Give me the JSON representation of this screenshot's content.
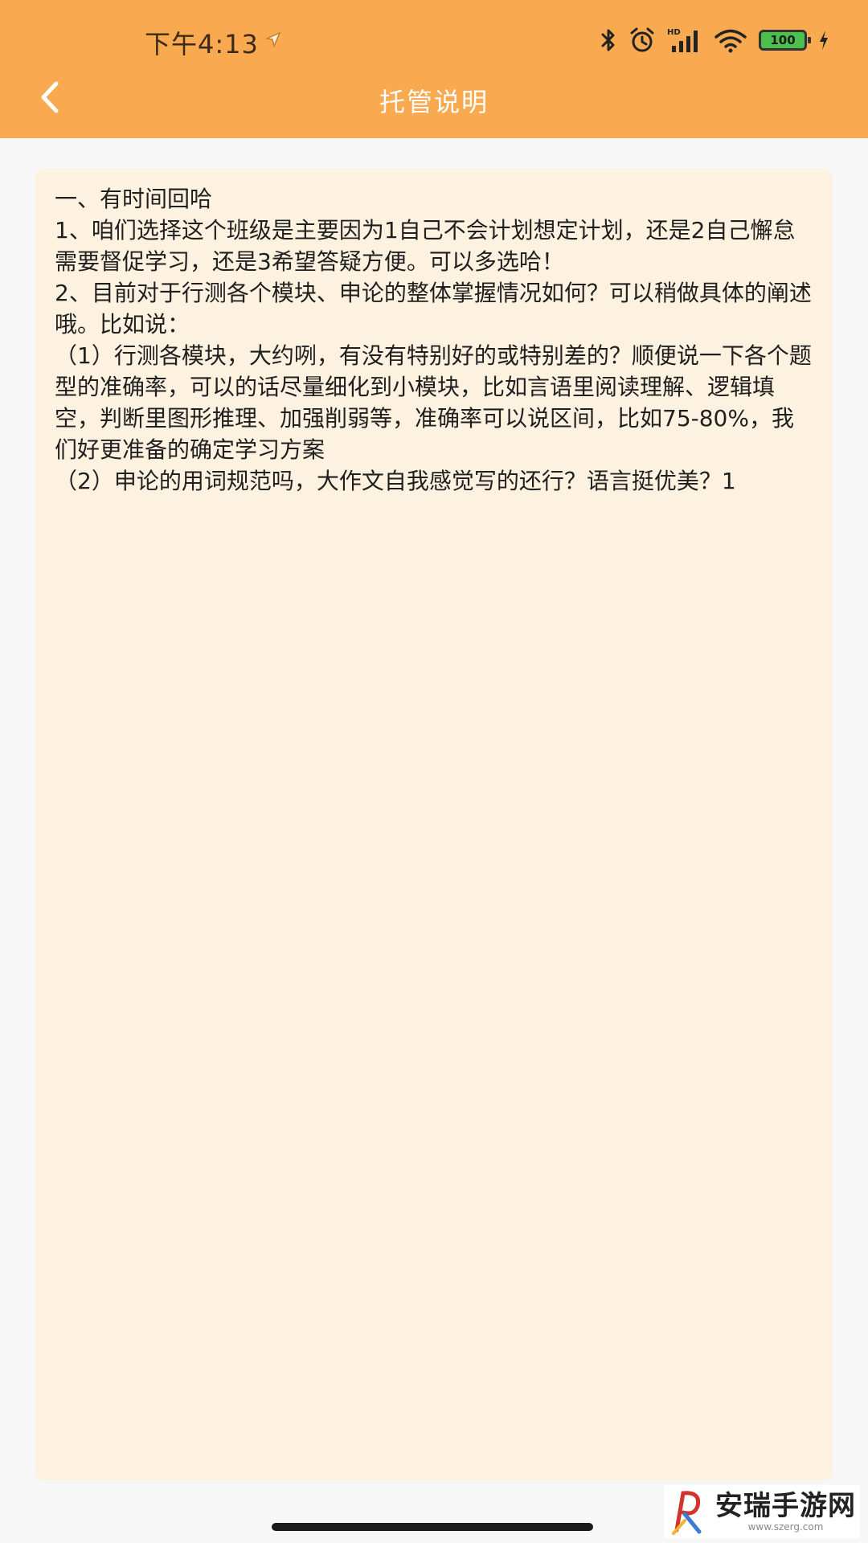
{
  "status_bar": {
    "time": "下午4:13",
    "hd_label": "HD",
    "battery_level": "100"
  },
  "header": {
    "title": "托管说明",
    "back_icon": "chevron-left-icon"
  },
  "content": {
    "lines": [
      "一、有时间回哈",
      "1、咱们选择这个班级是主要因为1自己不会计划想定计划，还是2自己懈怠需要督促学习，还是3希望答疑方便。可以多选哈！",
      "2、目前对于行测各个模块、申论的整体掌握情况如何？可以稍做具体的阐述哦。比如说：",
      "（1）行测各模块，大约咧，有没有特别好的或特别差的？顺便说一下各个题型的准确率，可以的话尽量细化到小模块，比如言语里阅读理解、逻辑填空，判断里图形推理、加强削弱等，准确率可以说区间，比如75-80%，我们好更准备的确定学习方案",
      "（2）申论的用词规范吗，大作文自我感觉写的还行？语言挺优美？1"
    ]
  },
  "watermark": {
    "name": "安瑞手游网",
    "url": "www.szerg.com"
  },
  "colors": {
    "header_bg": "#f9a94f",
    "card_bg": "#fdf1e0",
    "page_bg": "#f7f7f7"
  }
}
